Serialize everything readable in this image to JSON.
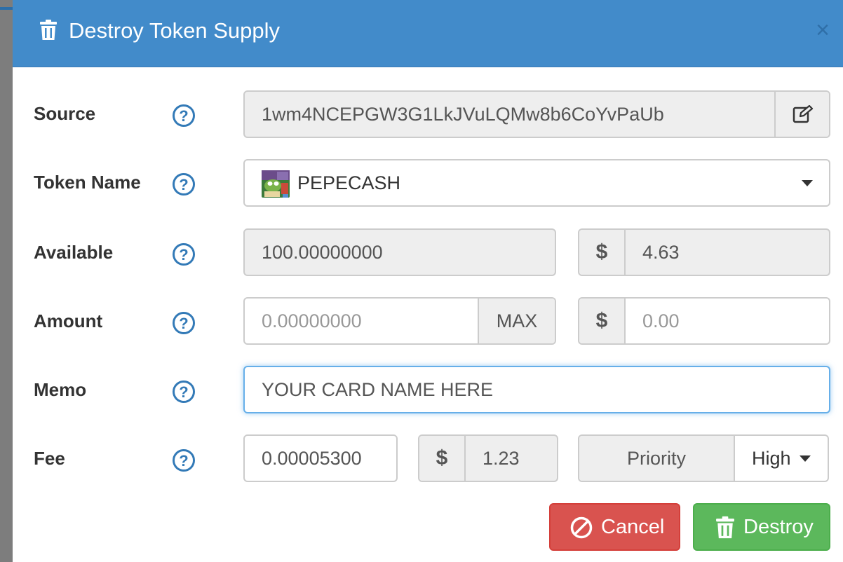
{
  "modal": {
    "title": "Destroy Token Supply",
    "close_label": "×"
  },
  "form": {
    "source": {
      "label": "Source",
      "value": "1wm4NCEPGW3G1LkJVuLQMw8b6CoYvPaUb"
    },
    "token_name": {
      "label": "Token Name",
      "value": "PEPECASH"
    },
    "available": {
      "label": "Available",
      "value": "100.00000000",
      "usd_symbol": "$",
      "usd_value": "4.63"
    },
    "amount": {
      "label": "Amount",
      "placeholder": "0.00000000",
      "max_label": "MAX",
      "usd_symbol": "$",
      "usd_placeholder": "0.00"
    },
    "memo": {
      "label": "Memo",
      "value": "YOUR CARD NAME HERE"
    },
    "fee": {
      "label": "Fee",
      "value": "0.00005300",
      "usd_symbol": "$",
      "usd_value": "1.23",
      "priority_label": "Priority",
      "priority_value": "High"
    }
  },
  "actions": {
    "cancel_label": "Cancel",
    "destroy_label": "Destroy"
  },
  "icons": {
    "header": "trash-icon",
    "help": "question-circle-icon",
    "edit": "edit-icon",
    "cancel": "ban-icon",
    "destroy": "trash-icon"
  },
  "colors": {
    "header_bg": "#428bca",
    "help_icon": "#337ab7",
    "cancel_bg": "#d9534f",
    "destroy_bg": "#5cb85c",
    "focus_border": "#66afe9"
  }
}
